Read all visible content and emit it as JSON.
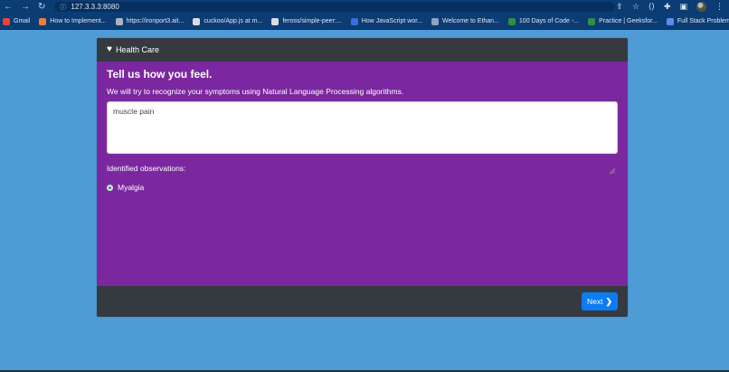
{
  "browser": {
    "url": "127.3.3.3:8080",
    "nav": {
      "back": "←",
      "forward": "→",
      "reload": "↻"
    },
    "bookmarks": [
      {
        "label": "Gmail",
        "color": "#ea4335"
      },
      {
        "label": "How to Implement...",
        "color": "#e8813a"
      },
      {
        "label": "https://ironport3.ait...",
        "color": "#aab4c2"
      },
      {
        "label": "cuckoo/App.js at m...",
        "color": "#d9dde3"
      },
      {
        "label": "feross/simple-peer:...",
        "color": "#d9dde3"
      },
      {
        "label": "How JavaScript wor...",
        "color": "#3b6fd9"
      },
      {
        "label": "Welcome to Ethan...",
        "color": "#8fa3c0"
      },
      {
        "label": "100 Days of Code -...",
        "color": "#2f8f46"
      },
      {
        "label": "Practice | Geeksfor...",
        "color": "#2f8f46"
      },
      {
        "label": "Full Stack Problem...",
        "color": "#5b8de8"
      }
    ]
  },
  "app": {
    "header_title": "Health Care",
    "title": "Tell us how you feel.",
    "description": "We will try to recognize your symptoms using Natural Language Processing algorithms.",
    "symptom_input_value": "muscle pain",
    "observations_label": "Identified observations:",
    "observations": [
      "Myalgia"
    ],
    "next_label": "Next"
  },
  "colors": {
    "page_bg": "#4e9bd6",
    "card_bg": "#7b28a0",
    "header_bg": "#343a40",
    "button": "#0d7bf2",
    "observation_dot": "#28a745"
  }
}
